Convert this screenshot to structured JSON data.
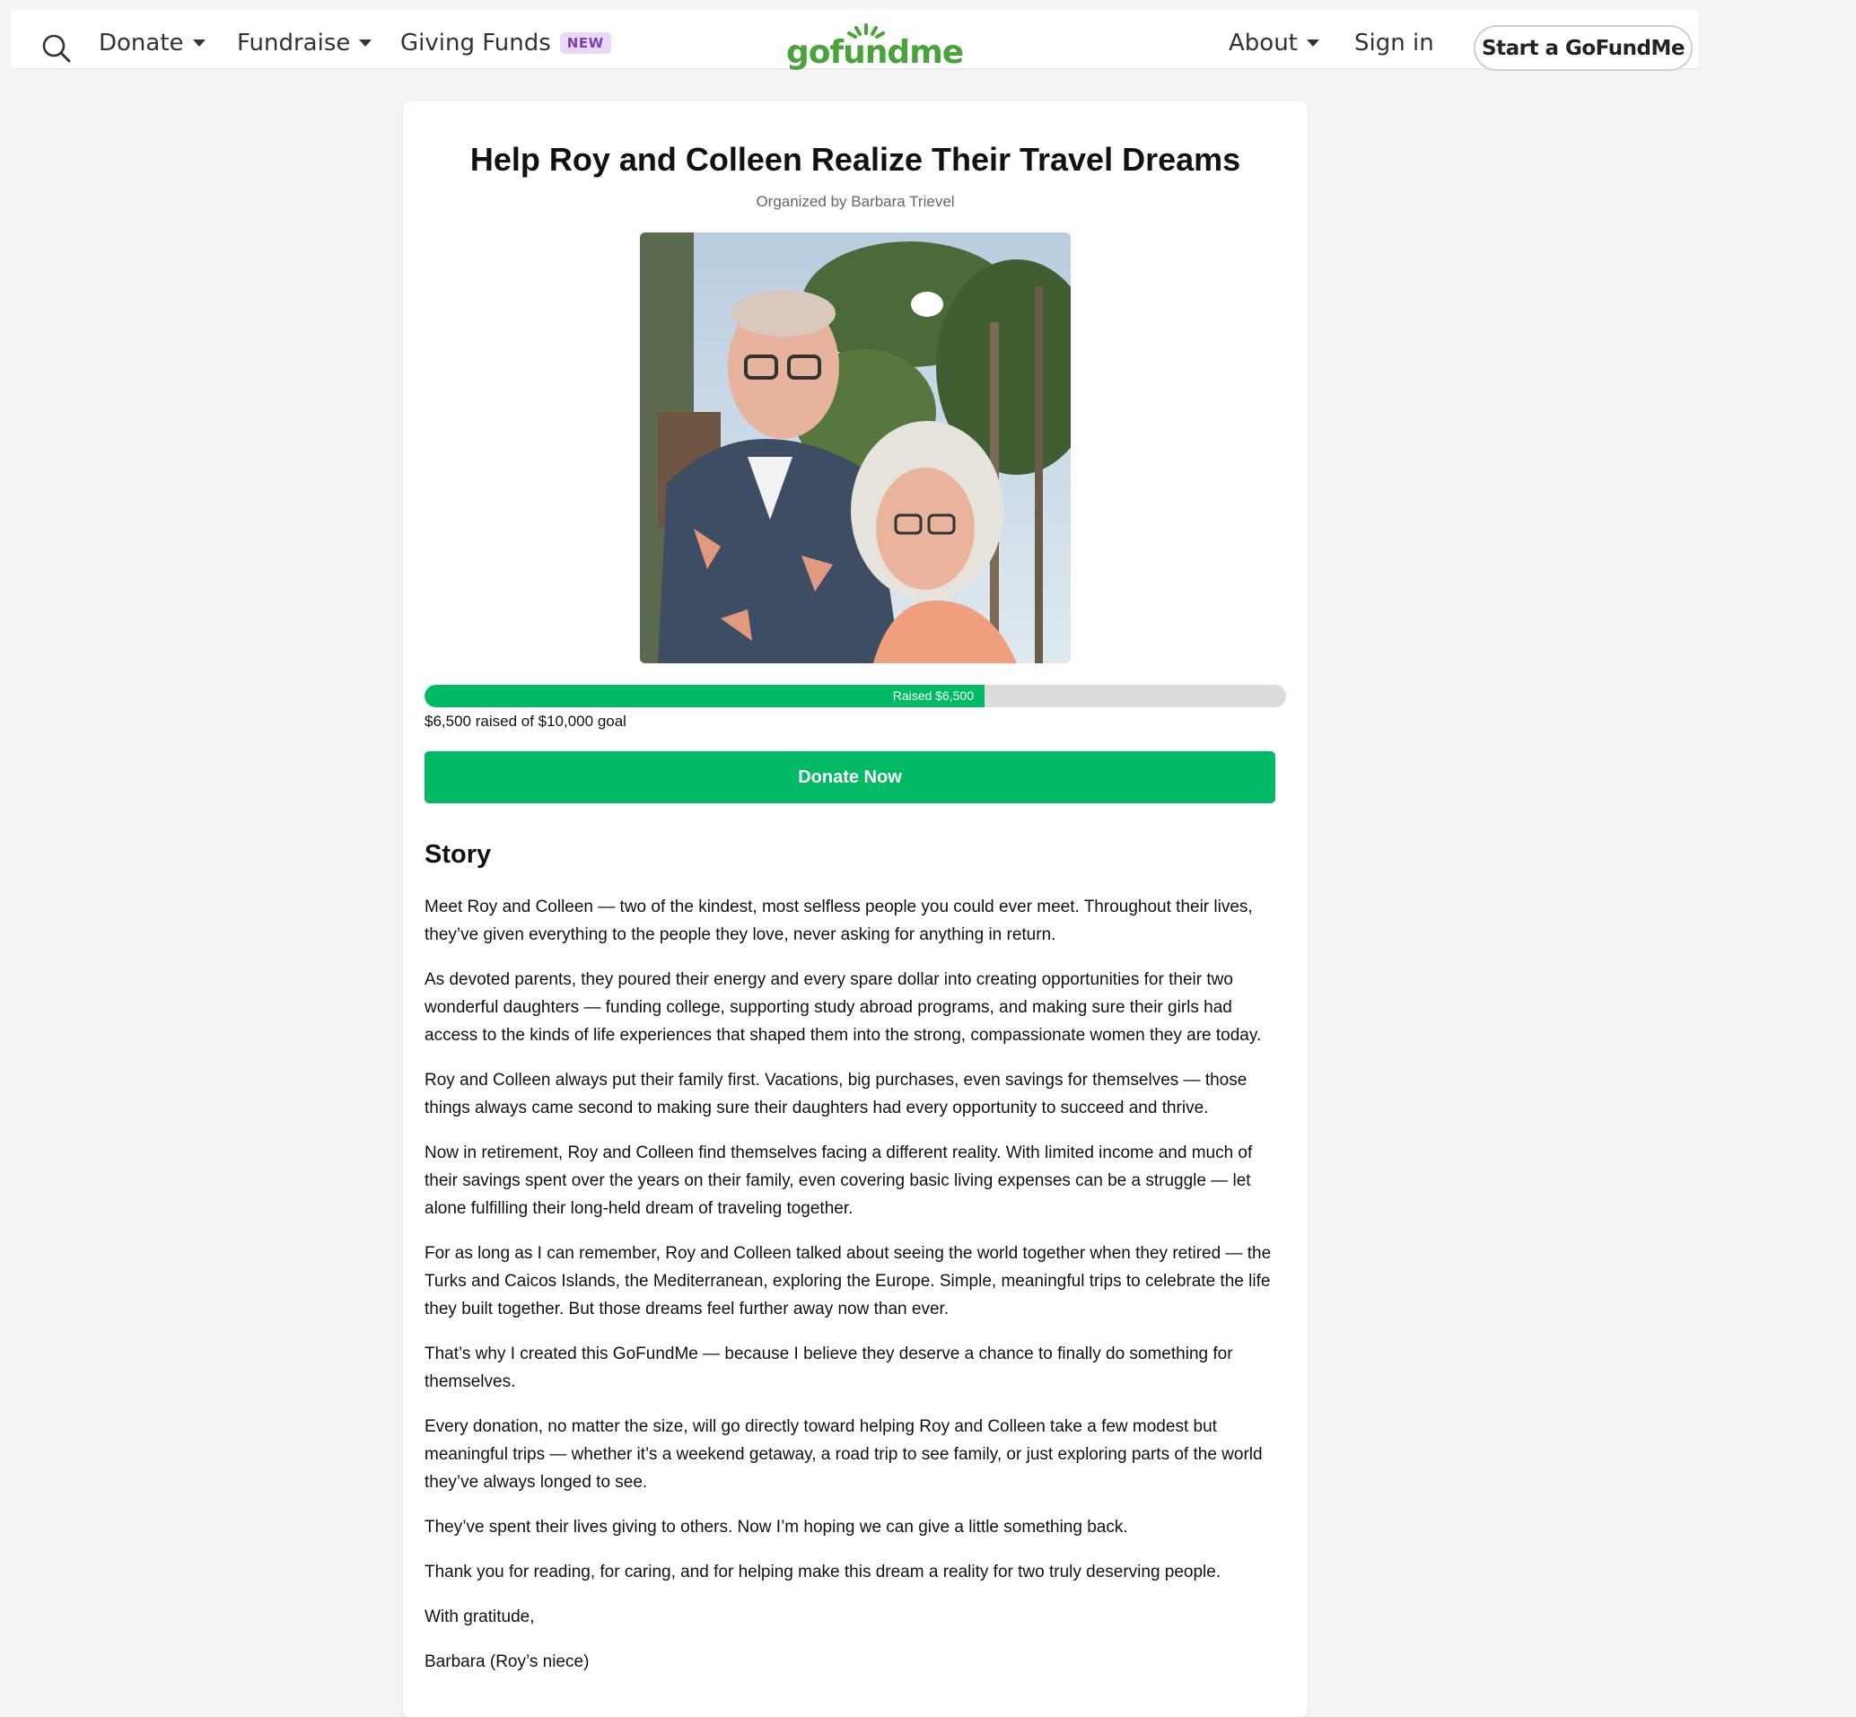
{
  "nav": {
    "donate": "Donate",
    "fundraise": "Fundraise",
    "giving_funds": "Giving Funds",
    "new_badge": "NEW",
    "logo": "gofundme",
    "about": "About",
    "sign_in": "Sign in",
    "start": "Start a GoFundMe"
  },
  "campaign": {
    "title": "Help Roy and Colleen Realize Their Travel Dreams",
    "organizer": "Organized by Barbara Trievel",
    "progress_label": "Raised $6,500",
    "progress_fraction": 0.65,
    "raised_text": "$6,500 raised of $10,000 goal",
    "donate_button": "Donate Now"
  },
  "story": {
    "heading": "Story",
    "paragraphs": [
      "Meet Roy and Colleen — two of the kindest, most selfless people you could ever meet. Throughout their lives, they’ve given everything to the people they love, never asking for anything in return.",
      "As devoted parents, they poured their energy and every spare dollar into creating opportunities for their two wonderful daughters — funding college, supporting study abroad programs, and making sure their girls had access to the kinds of life experiences that shaped them into the strong, compassionate women they are today.",
      "Roy and Colleen always put their family first. Vacations, big purchases, even savings for themselves — those things always came second to making sure their daughters had every opportunity to succeed and thrive.",
      "Now in retirement, Roy and Colleen find themselves facing a different reality. With limited income and much of their savings spent over the years on their family, even covering basic living expenses can be a struggle — let alone fulfilling their long-held dream of traveling together.",
      "For as long as I can remember, Roy and Colleen talked about seeing the world together when they retired — the Turks and Caicos Islands, the Mediterranean, exploring the Europe. Simple, meaningful trips to celebrate the life they built together. But those dreams feel further away now than ever.",
      "That’s why I created this GoFundMe — because I believe they deserve a chance to finally do something for themselves.",
      "Every donation, no matter the size, will go directly toward helping Roy and Colleen take a few modest but meaningful trips — whether it’s a weekend getaway, a road trip to see family, or just exploring parts of the world they’ve always longed to see.",
      "They’ve spent their lives giving to others. Now I’m hoping we can give a little something back.",
      "Thank you for reading, for caring, and for helping make this dream a reality for two truly deserving people.",
      "With gratitude,",
      "Barbara (Roy’s niece)"
    ]
  },
  "colors": {
    "brand_green": "#00b964",
    "logo_green": "#4aa23b",
    "badge_purple": "#7a3fb0"
  },
  "icons": {
    "search": "search-icon",
    "caret": "caret-down-icon",
    "logo": "gofundme-logo"
  }
}
